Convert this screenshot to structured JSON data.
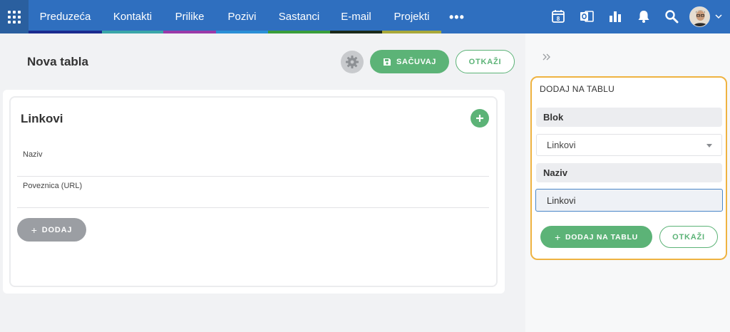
{
  "nav": {
    "items": [
      {
        "label": "Preduzeća",
        "color": "#1c2b8f"
      },
      {
        "label": "Kontakti",
        "color": "#3aa6a8"
      },
      {
        "label": "Prilike",
        "color": "#9b3aa8"
      },
      {
        "label": "Pozivi",
        "color": "#2a8fd6"
      },
      {
        "label": "Sastanci",
        "color": "#3a9e3a"
      },
      {
        "label": "E-mail",
        "color": "#1a2a1a"
      },
      {
        "label": "Projekti",
        "color": "#a8a83a"
      }
    ],
    "more": "•••",
    "icons": [
      "calendar-icon",
      "outlook-icon",
      "chart-icon",
      "bell-icon",
      "search-icon"
    ],
    "calendar_day": "8"
  },
  "page": {
    "title": "Nova tabla",
    "save_label": "SAČUVAJ",
    "cancel_label": "OTKAŽI"
  },
  "block": {
    "title": "Linkovi",
    "fields": [
      "Naziv",
      "Poveznica (URL)"
    ],
    "add_label": "DODAJ"
  },
  "panel": {
    "title": "DODAJ NA TABLU",
    "block_label": "Blok",
    "block_selected": "Linkovi",
    "name_label": "Naziv",
    "name_value": "Linkovi",
    "add_label": "DODAJ NA TABLU",
    "cancel_label": "OTKAŽI"
  },
  "colors": {
    "topbar": "#2f6fbf",
    "accent_green": "#5cb377",
    "panel_border": "#efb341"
  }
}
